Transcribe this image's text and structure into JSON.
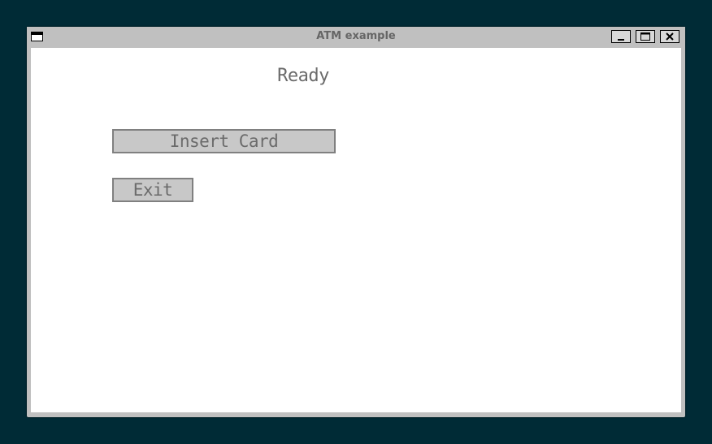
{
  "window": {
    "title": "ATM example"
  },
  "titlebar_buttons": {
    "minimize_icon": "minimize-icon",
    "maximize_icon": "maximize-icon",
    "close_icon": "close-icon"
  },
  "status": {
    "text": "Ready"
  },
  "buttons": {
    "insert_card": "Insert Card",
    "exit": "Exit"
  },
  "colors": {
    "desktop": "#002b36",
    "window_frame": "#c0c0c0",
    "client_bg": "#ffffff",
    "button_bg": "#c8c8c8",
    "button_border": "#808080",
    "text": "#6b6b6b"
  }
}
